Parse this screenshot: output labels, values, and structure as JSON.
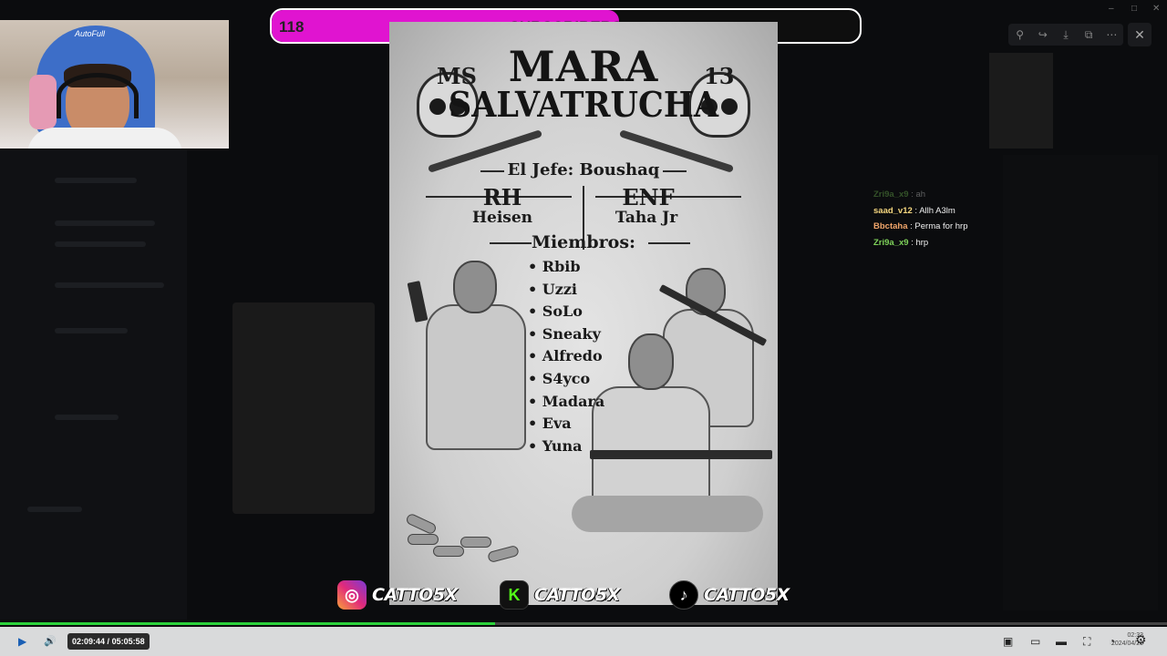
{
  "subscriber_goal": {
    "count": "118",
    "label": "SUBSCRIBERS",
    "progress": 0.59,
    "fill_color": "#e014d0"
  },
  "webcam": {
    "chair_brand": "AutoFull"
  },
  "viewer_toolbar": {
    "icons": [
      "zoom-icon",
      "share-icon",
      "download-icon",
      "open-external-icon",
      "more-icon"
    ],
    "close_icon": "close-icon",
    "zoom_glyph": "⚲",
    "share_glyph": "↪",
    "download_glyph": "⤓",
    "external_glyph": "⧉",
    "more_glyph": "⋯",
    "close_glyph": "✕"
  },
  "window_controls": {
    "minimize": "–",
    "maximize": "□",
    "close": "✕"
  },
  "poster": {
    "title_line1": "MARA",
    "title_line2": "SALVATRUCHA",
    "tag_left": "MS",
    "tag_right": "13",
    "jefe": "El Jefe: Boushaq",
    "rank_left": "RH",
    "rank_left_name": "Heisen",
    "rank_right": "ENF",
    "rank_right_name": "Taha Jr",
    "miembros_heading": "Miembros:",
    "members": [
      "Rbib",
      "Uzzi",
      "SoLo",
      "Sneaky",
      "Alfredo",
      "S4yco",
      "Madara",
      "Eva",
      "Yuna"
    ]
  },
  "chat": {
    "messages": [
      {
        "user": "Zri9a_x9",
        "text": "ah",
        "color": "#7fd35a",
        "faded": true
      },
      {
        "user": "saad_v12",
        "text": "Allh A3lm",
        "color": "#f5d77f",
        "faded": false
      },
      {
        "user": "Bbctaha",
        "text": "Perma for hrp",
        "color": "#f0a56a",
        "faded": false
      },
      {
        "user": "Zri9a_x9",
        "text": "hrp",
        "color": "#7fd35a",
        "faded": false
      }
    ]
  },
  "socials": [
    {
      "platform": "instagram",
      "handle": "CATTO5X",
      "icon_glyph": "◎",
      "color": "#d6249f"
    },
    {
      "platform": "kick",
      "handle": "CATTO5X",
      "icon_glyph": "K",
      "color": "#53fc18"
    },
    {
      "platform": "tiktok",
      "handle": "CATTO5X",
      "icon_glyph": "♪",
      "color": "#000000"
    }
  ],
  "player": {
    "current_time": "02:09:44",
    "separator": "/",
    "duration": "05:05:58",
    "progress": 0.424,
    "progress_color": "#2bd23b",
    "play_glyph": "▶",
    "volume_glyph": "🔊",
    "settings_glyph": "⚙",
    "clock_time": "02:33",
    "clock_date": "2024/04/26"
  }
}
